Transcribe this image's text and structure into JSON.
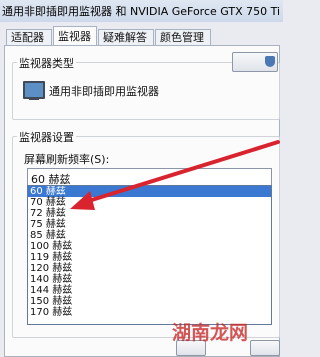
{
  "window": {
    "title": "通用非即插即用监视器 和 NVIDIA GeForce GTX 750 Ti"
  },
  "tabs": [
    {
      "label": "适配器",
      "active": false
    },
    {
      "label": "监视器",
      "active": true
    },
    {
      "label": "疑难解答",
      "active": false
    },
    {
      "label": "颜色管理",
      "active": false
    }
  ],
  "monitor_type": {
    "group_label": "监视器类型",
    "name": "通用非即插即用监视器"
  },
  "monitor_settings": {
    "group_label": "监视器设置",
    "refresh_label": "屏幕刷新频率(S):",
    "selected": "60 赫兹",
    "options": [
      "60 赫兹",
      "70 赫兹",
      "72 赫兹",
      "75 赫兹",
      "85 赫兹",
      "100 赫兹",
      "119 赫兹",
      "120 赫兹",
      "140 赫兹",
      "144 赫兹",
      "150 赫兹",
      "170 赫兹"
    ]
  },
  "watermark": "湖南龙网",
  "colors": {
    "selection": "#3b78d1",
    "arrow": "#d9232e",
    "watermark": "#c82828"
  }
}
